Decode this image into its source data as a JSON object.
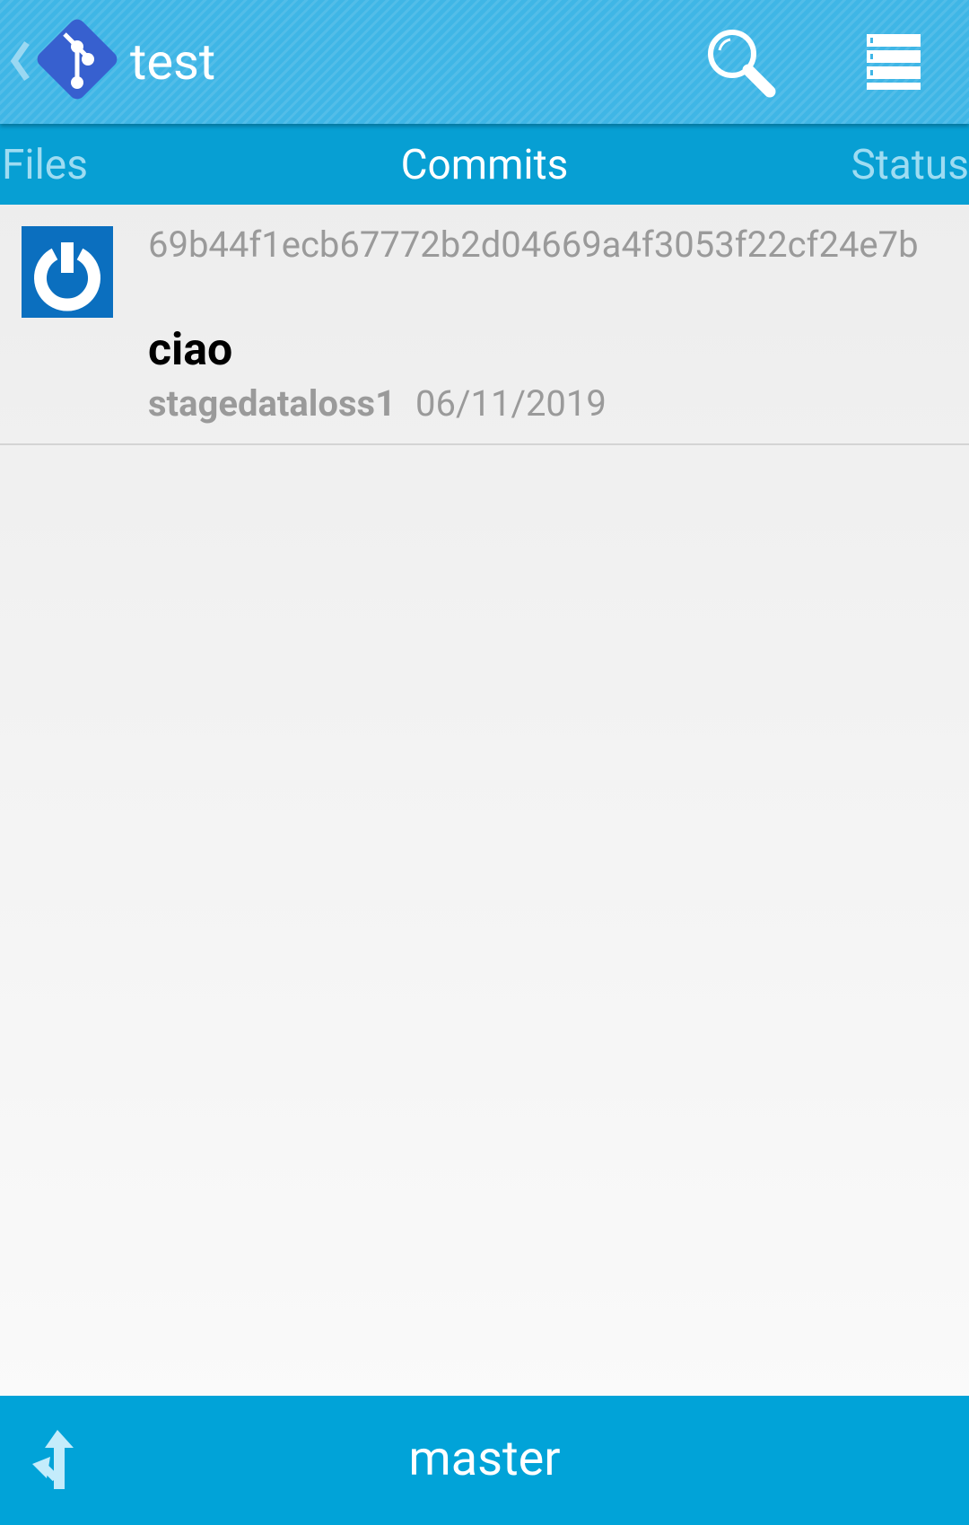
{
  "action_bar": {
    "title": "test",
    "background_color": "#3fb6e6",
    "icons": {
      "up": "chevron-left-icon",
      "logo": "git-logo-icon",
      "search": "search-icon",
      "menu": "overflow-menu-icon"
    }
  },
  "tabs": [
    {
      "label": "Files",
      "selected": false
    },
    {
      "label": "Commits",
      "selected": true
    },
    {
      "label": "Status",
      "selected": false
    }
  ],
  "commits": [
    {
      "sha": "69b44f1ecb67772b2d04669a4f3053f22cf24e7b",
      "message": "ciao",
      "author": "stagedataloss1",
      "date": "06/11/2019",
      "avatar_icon": "power-icon"
    }
  ],
  "bottom_bar": {
    "branch": "master",
    "branch_icon": "branch-icon",
    "background_color": "#01a3d8"
  }
}
